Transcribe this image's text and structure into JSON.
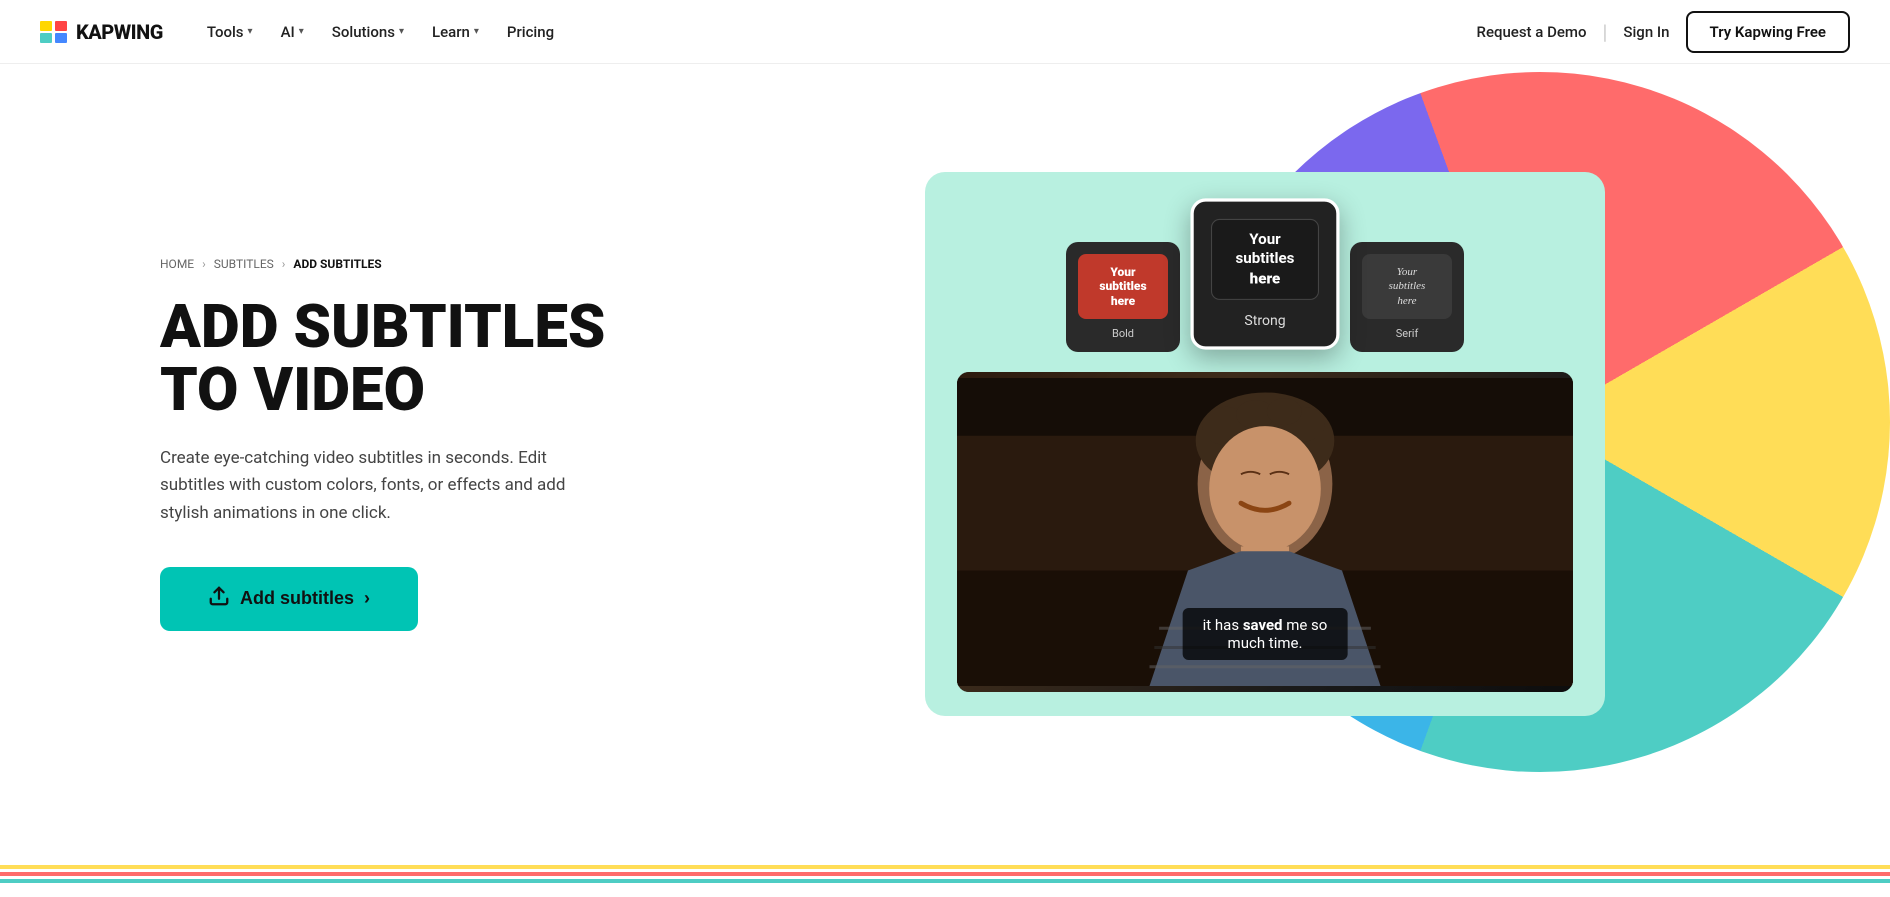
{
  "navbar": {
    "logo_text": "KAPWING",
    "nav_items": [
      {
        "label": "Tools",
        "has_dropdown": true
      },
      {
        "label": "AI",
        "has_dropdown": true
      },
      {
        "label": "Solutions",
        "has_dropdown": true
      },
      {
        "label": "Learn",
        "has_dropdown": true
      },
      {
        "label": "Pricing",
        "has_dropdown": false
      }
    ],
    "request_demo": "Request a Demo",
    "sign_in": "Sign In",
    "try_free": "Try Kapwing Free"
  },
  "breadcrumb": {
    "home": "HOME",
    "subtitles": "SUBTITLES",
    "current": "ADD SUBTITLES"
  },
  "hero": {
    "title_line1": "ADD SUBTITLES",
    "title_line2": "TO VIDEO",
    "description": "Create eye-catching video subtitles in seconds. Edit subtitles with custom colors, fonts, or effects and add stylish animations in one click.",
    "cta_label": "Add subtitles"
  },
  "style_cards": [
    {
      "label": "Bold",
      "preview_text": "Your subtitles here",
      "style": "bold"
    },
    {
      "label": "Strong",
      "preview_text": "Your subtitles here",
      "style": "strong",
      "active": true
    },
    {
      "label": "Serif",
      "preview_text": "Your subtitles here",
      "style": "serif"
    }
  ],
  "video": {
    "subtitle_text_normal": "it has ",
    "subtitle_text_bold": "saved",
    "subtitle_text_normal2": " me so",
    "subtitle_line2": "much time."
  },
  "colors": {
    "teal": "#00C4B4",
    "card_bg": "#B8F0E0",
    "circle_pink": "#FF6B6B",
    "circle_yellow": "#FFDD57",
    "circle_teal": "#4ECDC4",
    "circle_blue": "#3BB5E8"
  }
}
